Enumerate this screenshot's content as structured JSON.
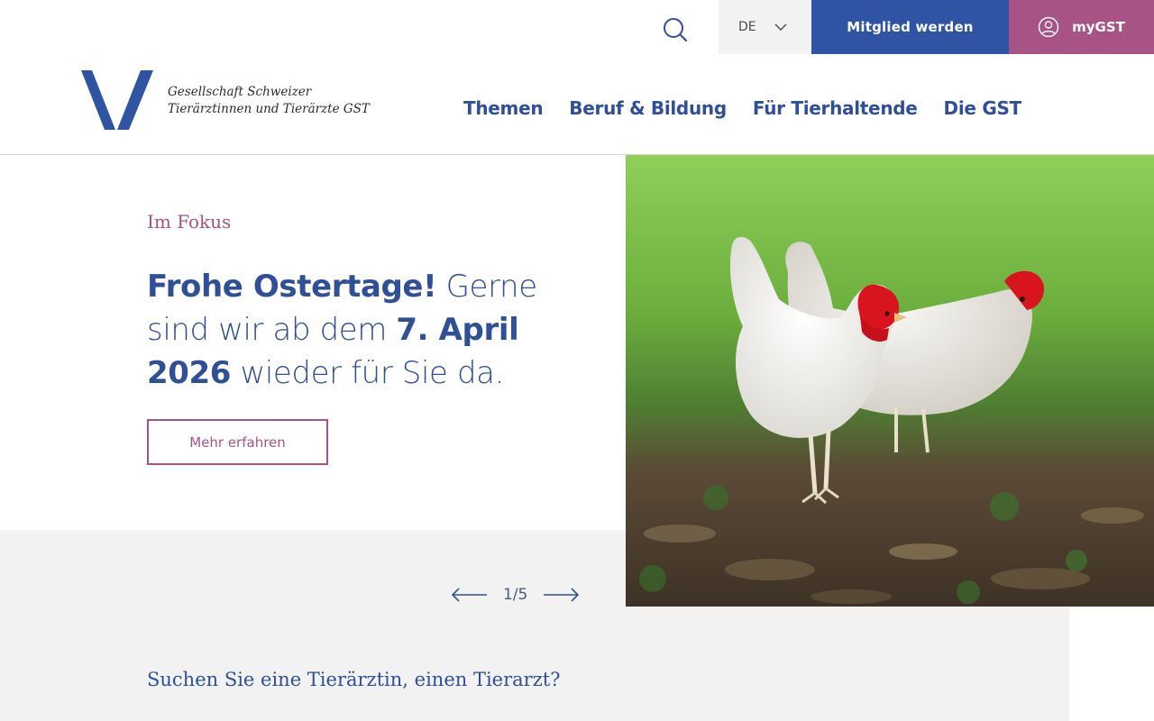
{
  "utility": {
    "language": "DE",
    "member_label": "Mitglied werden",
    "mygst_label": "myGST"
  },
  "logo": {
    "line1": "Gesellschaft Schweizer",
    "line2": "Tierärztinnen und Tierärzte GST"
  },
  "nav": {
    "items": [
      {
        "label": "Themen"
      },
      {
        "label": "Beruf & Bildung"
      },
      {
        "label": "Für Tierhaltende"
      },
      {
        "label": "Die GST"
      }
    ]
  },
  "hero": {
    "kicker": "Im Fokus",
    "headline_bold_1": "Frohe Ostertage!",
    "headline_text_1": " Gerne sind wir ab dem ",
    "headline_bold_2": "7. April 2026",
    "headline_text_2": " wieder für Sie da.",
    "button_label": "Mehr erfahren"
  },
  "pager": {
    "indicator": "1/5"
  },
  "section": {
    "find_vet_title": "Suchen Sie eine Tierärztin, einen Tierarzt?"
  },
  "colors": {
    "primary": "#2f54a3",
    "accent": "#a75385",
    "gray": "#f2f2f3"
  },
  "icons": {
    "search": "search-icon",
    "chevron": "chevron-down-icon",
    "user": "user-icon",
    "prev": "arrow-left-icon",
    "next": "arrow-right-icon"
  }
}
